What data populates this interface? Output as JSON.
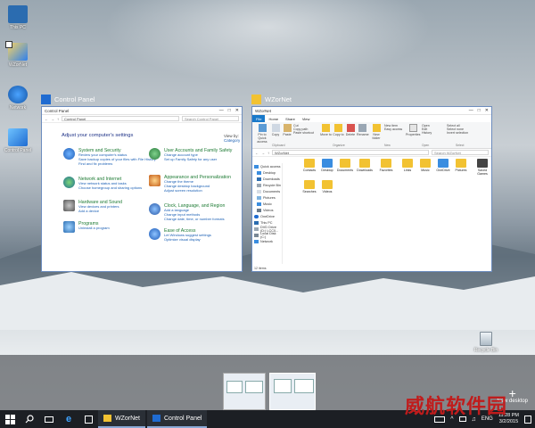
{
  "desktop": {
    "icons": [
      {
        "label": "This PC"
      },
      {
        "label": "WZorNet"
      },
      {
        "label": "Network"
      },
      {
        "label": "Control Panel"
      }
    ],
    "recycle_bin": "Recycle Bin"
  },
  "task_view": {
    "windows": [
      {
        "title": "Control Panel"
      },
      {
        "title": "WZorNet"
      }
    ],
    "new_desktop": "New desktop"
  },
  "control_panel": {
    "titlebar": "Control Panel",
    "address": "Control Panel",
    "search_placeholder": "Search Control Panel",
    "heading": "Adjust your computer's settings",
    "view_by_label": "View by:",
    "view_by_value": "Category",
    "categories": [
      {
        "title": "System and Security",
        "links": [
          "Review your computer's status",
          "Save backup copies of your files with File History",
          "Find and fix problems"
        ]
      },
      {
        "title": "Network and Internet",
        "links": [
          "View network status and tasks",
          "Choose homegroup and sharing options"
        ]
      },
      {
        "title": "Hardware and Sound",
        "links": [
          "View devices and printers",
          "Add a device"
        ]
      },
      {
        "title": "Programs",
        "links": [
          "Uninstall a program"
        ]
      },
      {
        "title": "User Accounts and Family Safety",
        "links": [
          "Change account type",
          "Set up Family Safety for any user"
        ]
      },
      {
        "title": "Appearance and Personalization",
        "links": [
          "Change the theme",
          "Change desktop background",
          "Adjust screen resolution"
        ]
      },
      {
        "title": "Clock, Language, and Region",
        "links": [
          "Add a language",
          "Change input methods",
          "Change date, time, or number formats"
        ]
      },
      {
        "title": "Ease of Access",
        "links": [
          "Let Windows suggest settings",
          "Optimize visual display"
        ]
      }
    ]
  },
  "explorer": {
    "titlebar": "WZorNet",
    "tabs": [
      "File",
      "Home",
      "Share",
      "View"
    ],
    "ribbon": {
      "buttons": [
        "Pin to Quick access",
        "Copy",
        "Paste",
        "Move to",
        "Copy to",
        "Delete",
        "Rename",
        "New folder",
        "Properties"
      ],
      "small": [
        "Cut",
        "Copy path",
        "Paste shortcut",
        "New item",
        "Easy access",
        "Open",
        "Edit",
        "History",
        "Select all",
        "Select none",
        "Invert selection"
      ],
      "groups": [
        "Clipboard",
        "Organize",
        "New",
        "Open",
        "Select"
      ]
    },
    "address": "WZorNet",
    "search_placeholder": "Search WZorNet",
    "nav": [
      "Quick access",
      "Desktop",
      "Downloads",
      "Recycle Bin",
      "Documents",
      "Pictures",
      "Music",
      "Videos",
      "OneDrive",
      "This PC",
      "DVD Drive (D:) LCC0...",
      "Local Disk (C:)",
      "Network"
    ],
    "folders": [
      "Contacts",
      "Desktop",
      "Documents",
      "Downloads",
      "Favorites",
      "Links",
      "Music",
      "OneDrive",
      "Pictures",
      "Saved Games",
      "Searches",
      "Videos"
    ],
    "status": "12 items"
  },
  "taskbar": {
    "apps": [
      {
        "label": "WZorNet"
      },
      {
        "label": "Control Panel"
      }
    ],
    "lang": "ENG",
    "time": "11:28 PM",
    "date": "3/2/2015"
  },
  "watermark": "威航软件园",
  "colors": {
    "accent": "#1979ca",
    "taskbar": "#1c1f24",
    "cp_heading": "#1e3287",
    "cp_category": "#1e7b34",
    "link": "#1a5fb4",
    "folder": "#f2c232"
  }
}
